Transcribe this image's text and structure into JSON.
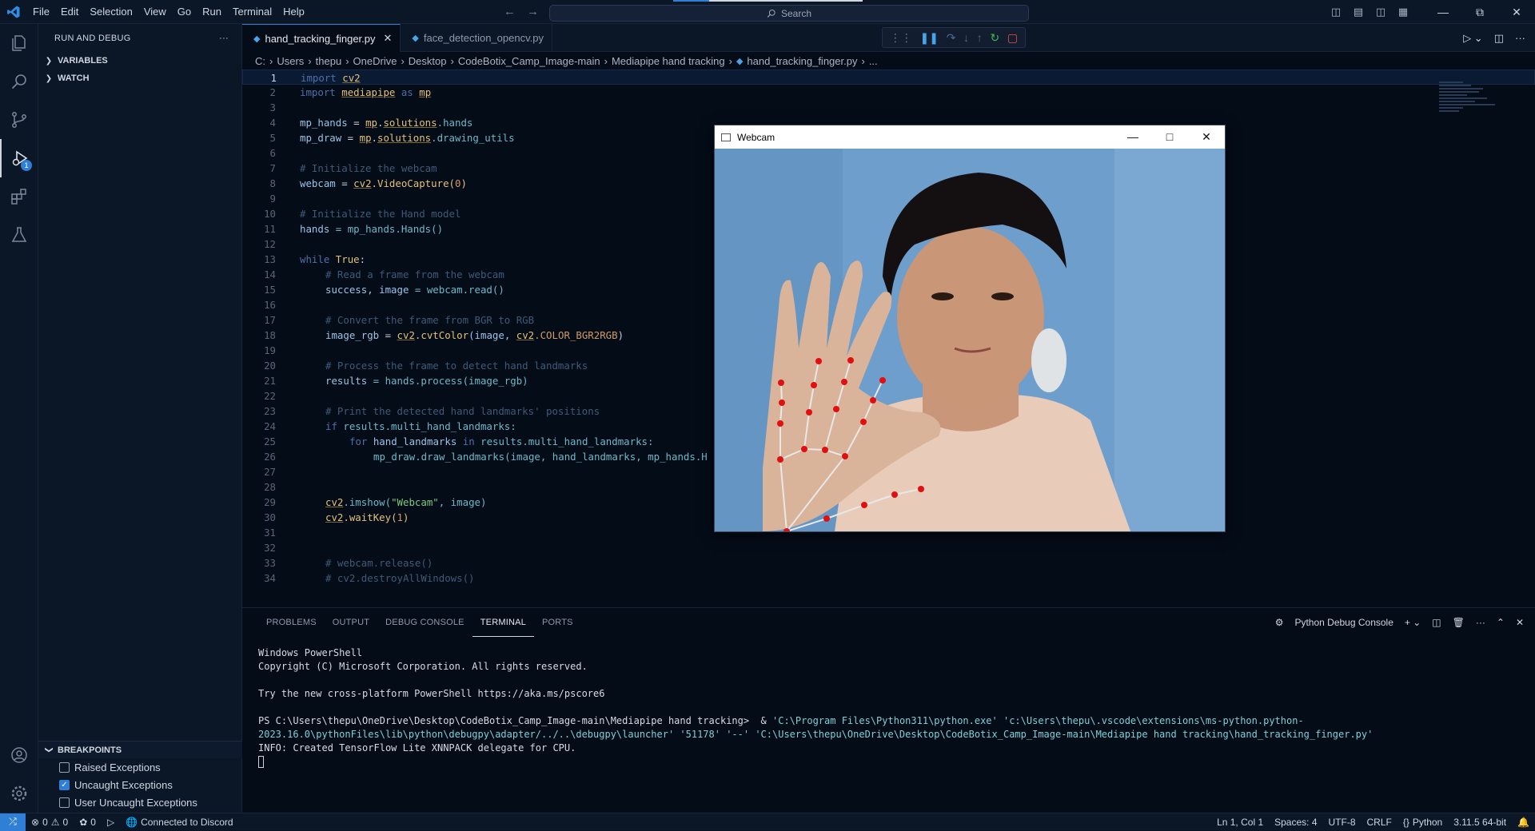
{
  "titlebar": {
    "menu": [
      "File",
      "Edit",
      "Selection",
      "View",
      "Go",
      "Run",
      "Terminal",
      "Help"
    ],
    "search_placeholder": "Search"
  },
  "sidebar": {
    "title": "RUN AND DEBUG",
    "more": "···",
    "sections": [
      "VARIABLES",
      "WATCH"
    ],
    "breakpoints_title": "BREAKPOINTS",
    "breakpoints": [
      {
        "label": "Raised Exceptions",
        "checked": false
      },
      {
        "label": "Uncaught Exceptions",
        "checked": true
      },
      {
        "label": "User Uncaught Exceptions",
        "checked": false
      }
    ]
  },
  "activity": {
    "debug_badge": "1"
  },
  "tabs": [
    {
      "label": "hand_tracking_finger.py",
      "active": true
    },
    {
      "label": "face_detection_opencv.py",
      "active": false
    }
  ],
  "breadcrumb": [
    "C:",
    "Users",
    "thepu",
    "OneDrive",
    "Desktop",
    "CodeBotix_Camp_Image-main",
    "Mediapipe hand tracking",
    "hand_tracking_finger.py",
    "..."
  ],
  "code": {
    "line_numbers": [
      "1",
      "2",
      "3",
      "4",
      "5",
      "6",
      "7",
      "8",
      "9",
      "10",
      "11",
      "12",
      "13",
      "14",
      "15",
      "16",
      "17",
      "18",
      "19",
      "20",
      "21",
      "22",
      "23",
      "24",
      "25",
      "26",
      "27",
      "28",
      "29",
      "30",
      "31",
      "32",
      "33",
      "34"
    ],
    "l1_kw": "import",
    "l1_mod": "cv2",
    "l2_kw": "import",
    "l2_mod": "mediapipe",
    "l2_as": "as",
    "l2_alias": "mp",
    "l4_var": "mp_hands",
    "l4_eq": " = ",
    "l4_mod": "mp",
    "l4_dot": ".",
    "l4_attr": "solutions",
    "l4_rest": ".hands",
    "l5_var": "mp_draw",
    "l5_eq": " = ",
    "l5_mod": "mp",
    "l5_dot": ".",
    "l5_attr": "solutions",
    "l5_rest": ".drawing_utils",
    "l7": "# Initialize the webcam",
    "l8_var": "webcam",
    "l8_eq": " = ",
    "l8_mod": "cv2",
    "l8_fn": ".VideoCapture(",
    "l8_num": "0",
    "l8_close": ")",
    "l10": "# Initialize the Hand model",
    "l11_var": "hands",
    "l11_rest": " = mp_hands.Hands()",
    "l13_kw": "while",
    "l13_true": "True",
    "l13_colon": ":",
    "l14": "# Read a frame from the webcam",
    "l15_a": "success, image",
    "l15_b": " = webcam.read()",
    "l17": "# Convert the frame from BGR to RGB",
    "l18_a": "image_rgb",
    "l18_b": " = ",
    "l18_mod": "cv2",
    "l18_fn": ".cvtColor",
    "l18_c": "(image, ",
    "l18_mod2": "cv2",
    "l18_const": ".COLOR_BGR2RGB",
    "l18_close": ")",
    "l20": "# Process the frame to detect hand landmarks",
    "l21_a": "results",
    "l21_b": " = hands.process(image_rgb)",
    "l23": "# Print the detected hand landmarks' positions",
    "l24_kw": "if",
    "l24_rest": " results.multi_hand_landmarks:",
    "l25_kw": "for",
    "l25_a": " hand_landmarks ",
    "l25_in": "in",
    "l25_rest": " results.multi_hand_landmarks:",
    "l26": "mp_draw.draw_landmarks(image, hand_landmarks, mp_hands.H",
    "l29_mod": "cv2",
    "l29_fn": ".imshow(",
    "l29_str": "\"Webcam\"",
    "l29_rest": ", image)",
    "l30_mod": "cv2",
    "l30_fn": ".waitKey(",
    "l30_num": "1",
    "l30_close": ")",
    "l33": "# webcam.release()",
    "l34": "# cv2.destroyAllWindows()"
  },
  "webcam_window": {
    "title": "Webcam"
  },
  "panel": {
    "tabs": [
      "PROBLEMS",
      "OUTPUT",
      "DEBUG CONSOLE",
      "TERMINAL",
      "PORTS"
    ],
    "active_tab": "TERMINAL",
    "console_label": "Python Debug Console",
    "terminal": {
      "l1": "Windows PowerShell",
      "l2": "Copyright (C) Microsoft Corporation. All rights reserved.",
      "l3": "Try the new cross-platform PowerShell https://aka.ms/pscore6",
      "l4_prompt": "PS C:\\Users\\thepu\\OneDrive\\Desktop\\CodeBotix_Camp_Image-main\\Mediapipe hand tracking>  & ",
      "l4_cmd": "'C:\\Program Files\\Python311\\python.exe' 'c:\\Users\\thepu\\.vscode\\extensions\\ms-python.python-2023.16.0\\pythonFiles\\lib\\python\\debugpy\\adapter/../..\\debugpy\\launcher' '51178' '--' 'C:\\Users\\thepu\\OneDrive\\Desktop\\CodeBotix_Camp_Image-main\\Mediapipe hand tracking\\hand_tracking_finger.py'",
      "l5": "INFO: Created TensorFlow Lite XNNPACK delegate for CPU."
    }
  },
  "statusbar": {
    "errors": "0",
    "warnings": "0",
    "ports": "0",
    "discord": "Connected to Discord",
    "position": "Ln 1, Col 1",
    "spaces": "Spaces: 4",
    "encoding": "UTF-8",
    "eol": "CRLF",
    "language": "Python",
    "interpreter": "3.11.5 64-bit"
  },
  "colors": {
    "accent": "#2f7fd6",
    "background": "#040c18",
    "landmark": "#e01010"
  }
}
